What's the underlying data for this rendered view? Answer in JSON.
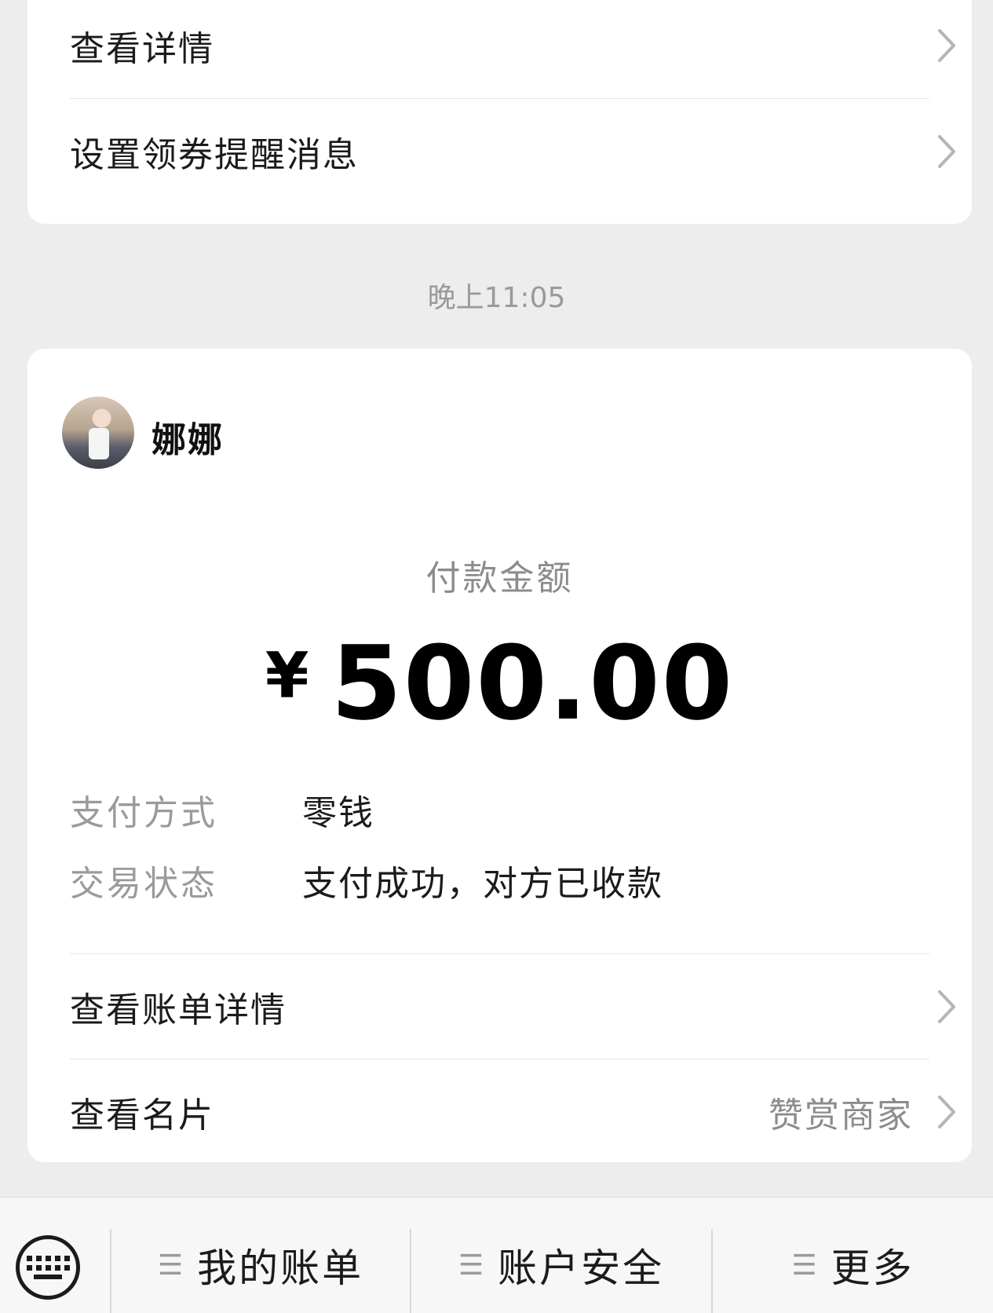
{
  "top_card": {
    "rows": [
      {
        "label": "查看详情"
      },
      {
        "label": "设置领券提醒消息"
      }
    ]
  },
  "timestamp": "晚上11:05",
  "payment": {
    "payee_name": "娜娜",
    "amount_label": "付款金额",
    "currency": "¥",
    "amount": "500.00",
    "method_label": "支付方式",
    "method_value": "零钱",
    "status_label": "交易状态",
    "status_value": "支付成功，对方已收款",
    "links": [
      {
        "label": "查看账单详情",
        "right": ""
      },
      {
        "label": "查看名片",
        "right": "赞赏商家"
      }
    ]
  },
  "bottom_menu": {
    "items": [
      {
        "label": "我的账单"
      },
      {
        "label": "账户安全"
      },
      {
        "label": "更多"
      }
    ]
  }
}
